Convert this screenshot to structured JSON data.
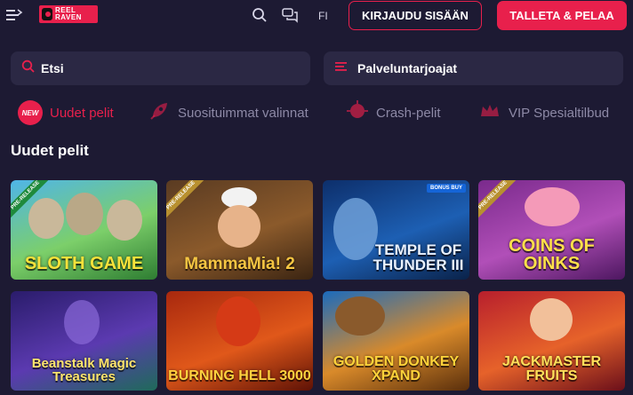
{
  "header": {
    "logo_text": "REEL RAVEN",
    "language": "FI",
    "login_label": "KIRJAUDU SISÄÄN",
    "deposit_label": "TALLETA & PELAA"
  },
  "search": {
    "label": "Etsi"
  },
  "providers": {
    "label": "Palveluntarjoajat"
  },
  "tabs": [
    {
      "label": "Uudet pelit",
      "badge": "NEW",
      "active": true
    },
    {
      "label": "Suosituimmat valinnat"
    },
    {
      "label": "Crash-pelit"
    },
    {
      "label": "VIP Spesialtilbud"
    }
  ],
  "section_title": "Uudet pelit",
  "games": [
    {
      "title": "SLOTH GAME",
      "ribbon": "PRE-RELEASE"
    },
    {
      "title": "MammaMia! 2",
      "ribbon": "PRE-RELEASE"
    },
    {
      "title": "TEMPLE OF THUNDER III",
      "tag": "BONUS BUY"
    },
    {
      "title": "COINS OF OINKS",
      "ribbon": "PRE-RELEASE"
    },
    {
      "title": "Beanstalk Magic Treasures"
    },
    {
      "title": "BURNING HELL 3000"
    },
    {
      "title": "GOLDEN DONKEY XPAND"
    },
    {
      "title": "JACKMASTER FRUITS"
    }
  ],
  "colors": {
    "background": "#1d1a33",
    "accent": "#e8204c",
    "panel": "#2b2844",
    "muted_text": "#8d89a6"
  }
}
